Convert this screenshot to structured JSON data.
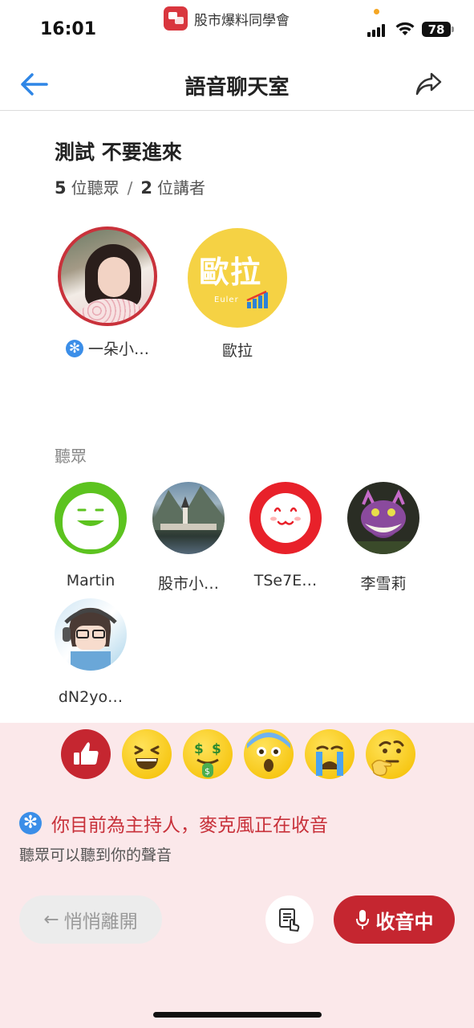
{
  "status_bar": {
    "time": "16:01",
    "app_name": "股市爆料同學會",
    "battery": "78"
  },
  "header": {
    "title": "語音聊天室",
    "back_icon": "arrow-left-icon",
    "share_icon": "share-icon"
  },
  "room": {
    "title": "測試 不要進來",
    "listener_count": "5",
    "listener_label": "位聽眾",
    "separator": "/",
    "speaker_count": "2",
    "speaker_label": "位講者"
  },
  "speakers": [
    {
      "name": "一朵小…",
      "is_host": true,
      "badge": "✻"
    },
    {
      "name": "歐拉",
      "is_host": false,
      "logo_text": "歐拉",
      "logo_sub": "Euler"
    }
  ],
  "listeners_section": {
    "label": "聽眾"
  },
  "listeners": [
    {
      "name": "Martin"
    },
    {
      "name": "股市小…"
    },
    {
      "name": "TSe7E…"
    },
    {
      "name": "李雪莉"
    },
    {
      "name": "dN2yo…"
    }
  ],
  "reactions": [
    "thumbs-up-icon",
    "laughing-emoji",
    "money-mouth-emoji",
    "astonished-emoji",
    "crying-emoji",
    "thinking-emoji"
  ],
  "host_status": {
    "badge": "✻",
    "message": "你目前為主持人，麥克風正在收音",
    "sub": "聽眾可以聽到你的聲音"
  },
  "actions": {
    "leave_label": "悄悄離開",
    "leave_arrow": "←",
    "mic_label": "收音中"
  },
  "colors": {
    "accent_red": "#c52630",
    "host_blue": "#3b8ee8",
    "panel_bg": "#fbe8ea",
    "link_blue": "#2f86e6"
  }
}
